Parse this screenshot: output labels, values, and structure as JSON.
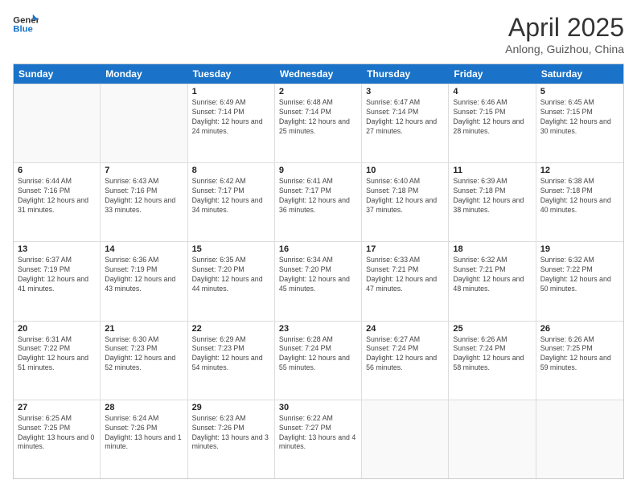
{
  "logo": {
    "line1": "General",
    "line2": "Blue"
  },
  "header": {
    "month": "April 2025",
    "location": "Anlong, Guizhou, China"
  },
  "weekdays": [
    "Sunday",
    "Monday",
    "Tuesday",
    "Wednesday",
    "Thursday",
    "Friday",
    "Saturday"
  ],
  "weeks": [
    [
      {
        "day": "",
        "info": ""
      },
      {
        "day": "",
        "info": ""
      },
      {
        "day": "1",
        "info": "Sunrise: 6:49 AM\nSunset: 7:14 PM\nDaylight: 12 hours and 24 minutes."
      },
      {
        "day": "2",
        "info": "Sunrise: 6:48 AM\nSunset: 7:14 PM\nDaylight: 12 hours and 25 minutes."
      },
      {
        "day": "3",
        "info": "Sunrise: 6:47 AM\nSunset: 7:14 PM\nDaylight: 12 hours and 27 minutes."
      },
      {
        "day": "4",
        "info": "Sunrise: 6:46 AM\nSunset: 7:15 PM\nDaylight: 12 hours and 28 minutes."
      },
      {
        "day": "5",
        "info": "Sunrise: 6:45 AM\nSunset: 7:15 PM\nDaylight: 12 hours and 30 minutes."
      }
    ],
    [
      {
        "day": "6",
        "info": "Sunrise: 6:44 AM\nSunset: 7:16 PM\nDaylight: 12 hours and 31 minutes."
      },
      {
        "day": "7",
        "info": "Sunrise: 6:43 AM\nSunset: 7:16 PM\nDaylight: 12 hours and 33 minutes."
      },
      {
        "day": "8",
        "info": "Sunrise: 6:42 AM\nSunset: 7:17 PM\nDaylight: 12 hours and 34 minutes."
      },
      {
        "day": "9",
        "info": "Sunrise: 6:41 AM\nSunset: 7:17 PM\nDaylight: 12 hours and 36 minutes."
      },
      {
        "day": "10",
        "info": "Sunrise: 6:40 AM\nSunset: 7:18 PM\nDaylight: 12 hours and 37 minutes."
      },
      {
        "day": "11",
        "info": "Sunrise: 6:39 AM\nSunset: 7:18 PM\nDaylight: 12 hours and 38 minutes."
      },
      {
        "day": "12",
        "info": "Sunrise: 6:38 AM\nSunset: 7:18 PM\nDaylight: 12 hours and 40 minutes."
      }
    ],
    [
      {
        "day": "13",
        "info": "Sunrise: 6:37 AM\nSunset: 7:19 PM\nDaylight: 12 hours and 41 minutes."
      },
      {
        "day": "14",
        "info": "Sunrise: 6:36 AM\nSunset: 7:19 PM\nDaylight: 12 hours and 43 minutes."
      },
      {
        "day": "15",
        "info": "Sunrise: 6:35 AM\nSunset: 7:20 PM\nDaylight: 12 hours and 44 minutes."
      },
      {
        "day": "16",
        "info": "Sunrise: 6:34 AM\nSunset: 7:20 PM\nDaylight: 12 hours and 45 minutes."
      },
      {
        "day": "17",
        "info": "Sunrise: 6:33 AM\nSunset: 7:21 PM\nDaylight: 12 hours and 47 minutes."
      },
      {
        "day": "18",
        "info": "Sunrise: 6:32 AM\nSunset: 7:21 PM\nDaylight: 12 hours and 48 minutes."
      },
      {
        "day": "19",
        "info": "Sunrise: 6:32 AM\nSunset: 7:22 PM\nDaylight: 12 hours and 50 minutes."
      }
    ],
    [
      {
        "day": "20",
        "info": "Sunrise: 6:31 AM\nSunset: 7:22 PM\nDaylight: 12 hours and 51 minutes."
      },
      {
        "day": "21",
        "info": "Sunrise: 6:30 AM\nSunset: 7:23 PM\nDaylight: 12 hours and 52 minutes."
      },
      {
        "day": "22",
        "info": "Sunrise: 6:29 AM\nSunset: 7:23 PM\nDaylight: 12 hours and 54 minutes."
      },
      {
        "day": "23",
        "info": "Sunrise: 6:28 AM\nSunset: 7:24 PM\nDaylight: 12 hours and 55 minutes."
      },
      {
        "day": "24",
        "info": "Sunrise: 6:27 AM\nSunset: 7:24 PM\nDaylight: 12 hours and 56 minutes."
      },
      {
        "day": "25",
        "info": "Sunrise: 6:26 AM\nSunset: 7:24 PM\nDaylight: 12 hours and 58 minutes."
      },
      {
        "day": "26",
        "info": "Sunrise: 6:26 AM\nSunset: 7:25 PM\nDaylight: 12 hours and 59 minutes."
      }
    ],
    [
      {
        "day": "27",
        "info": "Sunrise: 6:25 AM\nSunset: 7:25 PM\nDaylight: 13 hours and 0 minutes."
      },
      {
        "day": "28",
        "info": "Sunrise: 6:24 AM\nSunset: 7:26 PM\nDaylight: 13 hours and 1 minute."
      },
      {
        "day": "29",
        "info": "Sunrise: 6:23 AM\nSunset: 7:26 PM\nDaylight: 13 hours and 3 minutes."
      },
      {
        "day": "30",
        "info": "Sunrise: 6:22 AM\nSunset: 7:27 PM\nDaylight: 13 hours and 4 minutes."
      },
      {
        "day": "",
        "info": ""
      },
      {
        "day": "",
        "info": ""
      },
      {
        "day": "",
        "info": ""
      }
    ]
  ]
}
